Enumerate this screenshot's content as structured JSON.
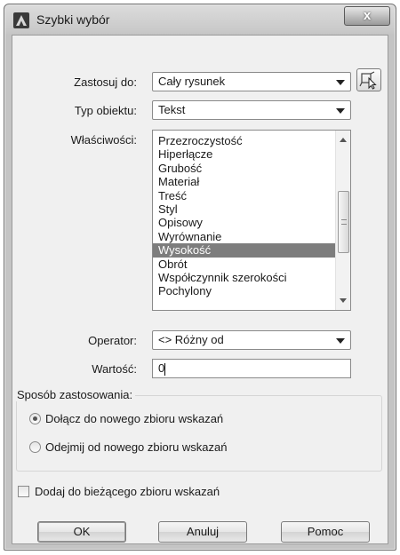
{
  "window": {
    "title": "Szybki wybór",
    "close_label": "x"
  },
  "form": {
    "apply_to": {
      "label": "Zastosuj do:",
      "value": "Cały rysunek"
    },
    "object_type": {
      "label": "Typ obiektu:",
      "value": "Tekst"
    },
    "properties": {
      "label": "Właściwości:",
      "items": [
        "Przezroczystość",
        "Hiperłącze",
        "Grubość",
        "Materiał",
        "Treść",
        "Styl",
        "Opisowy",
        "Wyrównanie",
        "Wysokość",
        "Obrót",
        "Współczynnik szerokości",
        "Pochylony"
      ],
      "selected_index": 8
    },
    "operator": {
      "label": "Operator:",
      "value": "<> Różny od"
    },
    "value": {
      "label": "Wartość:",
      "value": "0"
    }
  },
  "apply_mode": {
    "title": "Sposób zastosowania:",
    "options": [
      {
        "label": "Dołącz do nowego zbioru wskazań",
        "checked": true
      },
      {
        "label": "Odejmij od nowego zbioru wskazań",
        "checked": false
      }
    ]
  },
  "append_checkbox": {
    "label": "Dodaj do bieżącego zbioru wskazań",
    "checked": false
  },
  "buttons": {
    "ok": "OK",
    "cancel": "Anuluj",
    "help": "Pomoc"
  }
}
